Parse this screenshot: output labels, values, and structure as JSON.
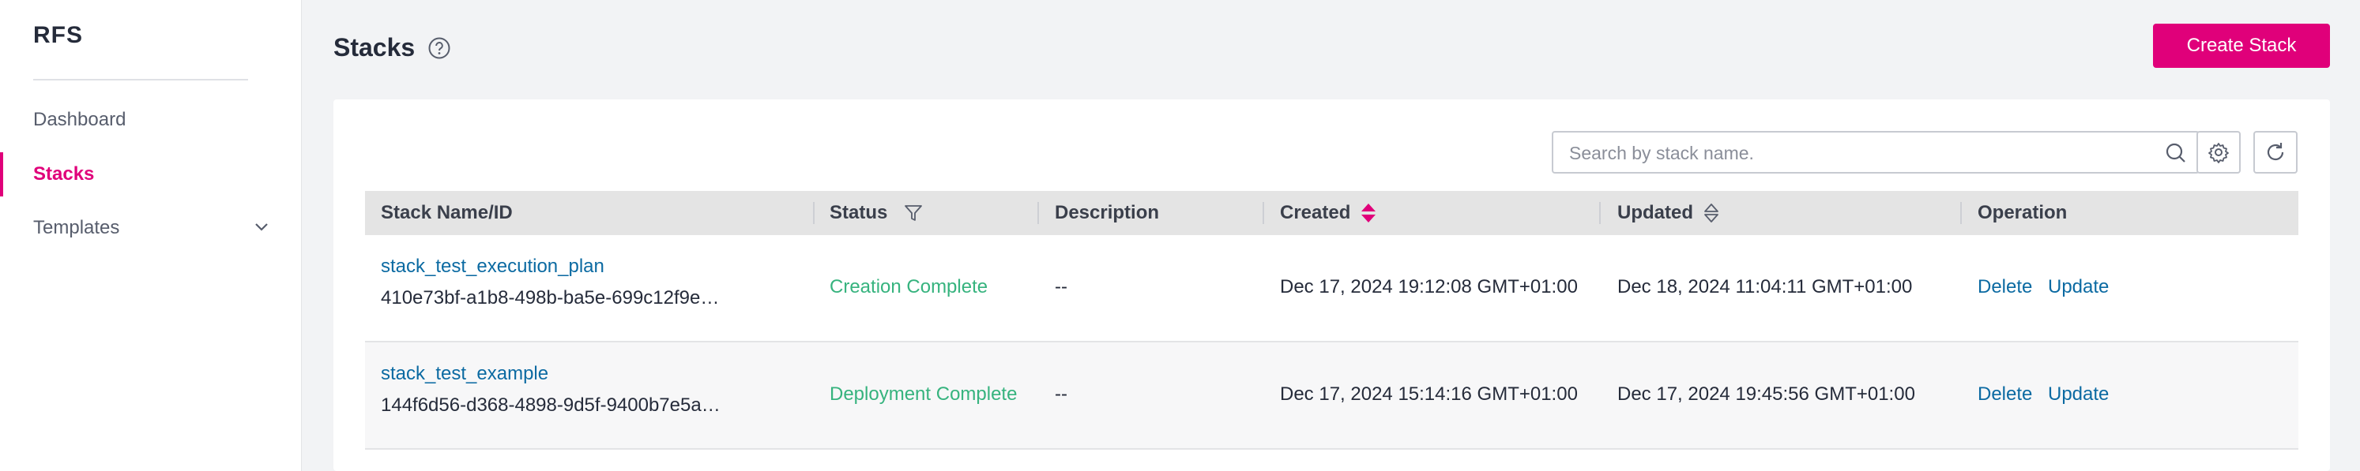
{
  "sidebar": {
    "brand": "RFS",
    "items": [
      {
        "label": "Dashboard"
      },
      {
        "label": "Stacks"
      },
      {
        "label": "Templates"
      }
    ]
  },
  "header": {
    "title": "Stacks",
    "create_button": "Create Stack"
  },
  "toolbar": {
    "search_placeholder": "Search by stack name."
  },
  "table": {
    "columns": [
      "Stack Name/ID",
      "Status",
      "Description",
      "Created",
      "Updated",
      "Operation"
    ],
    "rows": [
      {
        "name": "stack_test_execution_plan",
        "id": "410e73bf-a1b8-498b-ba5e-699c12f9e…",
        "status": "Creation Complete",
        "description": "--",
        "created": "Dec 17, 2024 19:12:08 GMT+01:00",
        "updated": "Dec 18, 2024 11:04:11 GMT+01:00",
        "ops": [
          "Delete",
          "Update"
        ]
      },
      {
        "name": "stack_test_example",
        "id": "144f6d56-d368-4898-9d5f-9400b7e5a…",
        "status": "Deployment Complete",
        "description": "--",
        "created": "Dec 17, 2024 15:14:16 GMT+01:00",
        "updated": "Dec 17, 2024 19:45:56 GMT+01:00",
        "ops": [
          "Delete",
          "Update"
        ]
      }
    ]
  },
  "colors": {
    "accent": "#e0007a",
    "link": "#0b6aa2",
    "status_ok": "#36b37e"
  },
  "icons": [
    "help-icon",
    "search-icon",
    "gear-icon",
    "refresh-icon",
    "filter-icon",
    "sort-icon",
    "chevron-down-icon"
  ]
}
